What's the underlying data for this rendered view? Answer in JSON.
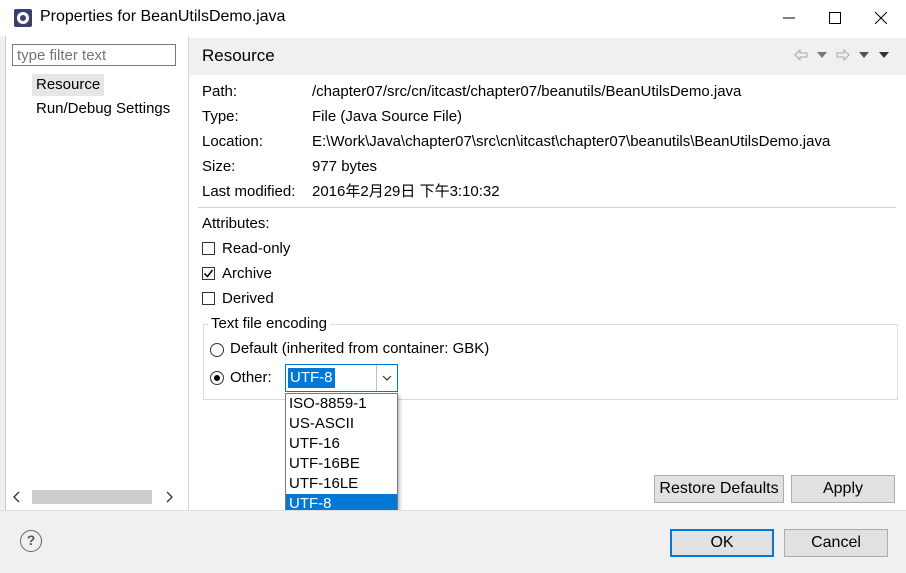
{
  "window": {
    "title": "Properties for BeanUtilsDemo.java",
    "minimize_icon": "minimize-icon",
    "maximize_icon": "maximize-icon",
    "close_icon": "close-icon"
  },
  "sidebar": {
    "filter_placeholder": "type filter text",
    "items": [
      {
        "label": "Resource",
        "selected": true
      },
      {
        "label": "Run/Debug Settings",
        "selected": false
      }
    ]
  },
  "page": {
    "title": "Resource",
    "nav_icons": [
      "back-arrow-icon",
      "forward-arrow-icon",
      "view-menu-icon"
    ]
  },
  "info": {
    "path_label": "Path:",
    "path_value": "/chapter07/src/cn/itcast/chapter07/beanutils/BeanUtilsDemo.java",
    "type_label": "Type:",
    "type_value": "File  (Java Source File)",
    "location_label": "Location:",
    "location_value": "E:\\Work\\Java\\chapter07\\src\\cn\\itcast\\chapter07\\beanutils\\BeanUtilsDemo.java",
    "size_label": "Size:",
    "size_value": "977  bytes",
    "modified_label": "Last modified:",
    "modified_value": "2016年2月29日 下午3:10:32"
  },
  "attributes": {
    "heading": "Attributes:",
    "readonly_label": "Read-only",
    "readonly_checked": false,
    "archive_label": "Archive",
    "archive_checked": true,
    "derived_label": "Derived",
    "derived_checked": false
  },
  "encoding": {
    "group_label": "Text file encoding",
    "default_label": "Default (inherited from container: GBK)",
    "other_label": "Other:",
    "selected_option": "other",
    "combo_value": "UTF-8",
    "options": [
      "ISO-8859-1",
      "US-ASCII",
      "UTF-16",
      "UTF-16BE",
      "UTF-16LE",
      "UTF-8"
    ]
  },
  "buttons": {
    "restore_defaults": "Restore Defaults",
    "apply": "Apply",
    "ok": "OK",
    "cancel": "Cancel",
    "help": "?"
  },
  "colors": {
    "accent": "#0078d7",
    "header_bg": "#f0f0f0"
  }
}
